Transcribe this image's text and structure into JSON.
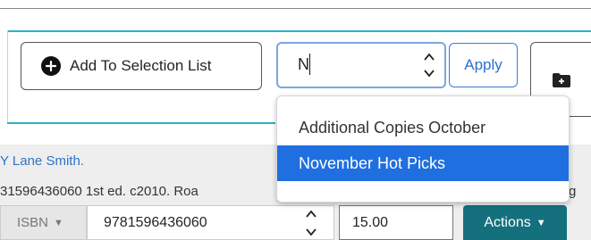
{
  "toolbar": {
    "add_label": "Add To Selection List",
    "search_value": "N",
    "apply_label": "Apply"
  },
  "dropdown": {
    "options": [
      "Additional Copies October",
      "November Hot Picks"
    ],
    "highlighted_index": 1
  },
  "record": {
    "author_fragment": "Y Lane Smith.",
    "details_fragment": "31596436060  1st ed. c2010. Roa",
    "details_tail": "g",
    "id_type": "ISBN",
    "id_value": "9781596436060",
    "price": "15.00",
    "actions_label": "Actions"
  },
  "colors": {
    "accent_teal": "#23b4c8",
    "highlight_blue": "#1f6fe0",
    "actions_bg": "#15707e",
    "link_blue": "#2c74c9"
  }
}
